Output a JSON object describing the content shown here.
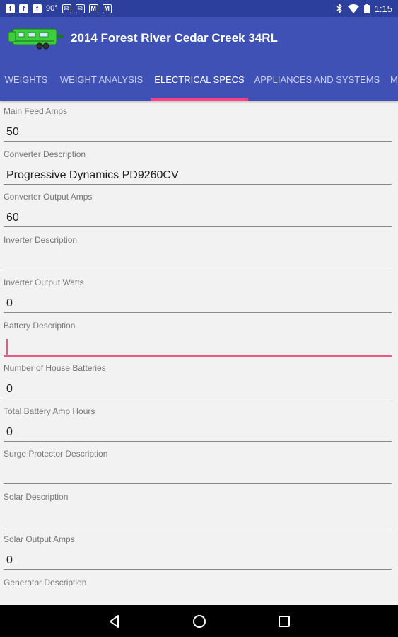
{
  "status_bar": {
    "left_icons": [
      "facebook-icon",
      "facebook-icon",
      "facebook-icon",
      "weather-icon",
      "email-icon",
      "email-icon",
      "gmail-icon",
      "gmail-icon"
    ],
    "temperature": "90°",
    "time": "1:15"
  },
  "app_bar": {
    "title": "2014 Forest River Cedar Creek 34RL",
    "logo_color": "#3ccf3c"
  },
  "tabs": [
    {
      "label": "WEIGHTS"
    },
    {
      "label": "WEIGHT ANALYSIS"
    },
    {
      "label": "ELECTRICAL SPECS"
    },
    {
      "label": "APPLIANCES AND SYSTEMS"
    },
    {
      "label": "M"
    }
  ],
  "colors": {
    "primary": "#3f51b5",
    "primary_dark": "#2c3f9c",
    "accent": "#ff4081"
  },
  "fields": [
    {
      "label": "Main Feed Amps",
      "value": "50"
    },
    {
      "label": "Converter Description",
      "value": "Progressive Dynamics PD9260CV"
    },
    {
      "label": "Converter Output Amps",
      "value": "60"
    },
    {
      "label": "Inverter Description",
      "value": ""
    },
    {
      "label": "Inverter Output Watts",
      "value": "0"
    },
    {
      "label": "Battery Description",
      "value": ""
    },
    {
      "label": "Number of House Batteries",
      "value": "0"
    },
    {
      "label": "Total Battery Amp Hours",
      "value": "0"
    },
    {
      "label": "Surge Protector Description",
      "value": ""
    },
    {
      "label": "Solar Description",
      "value": ""
    },
    {
      "label": "Solar Output Amps",
      "value": "0"
    },
    {
      "label": "Generator Description",
      "value": ""
    }
  ]
}
